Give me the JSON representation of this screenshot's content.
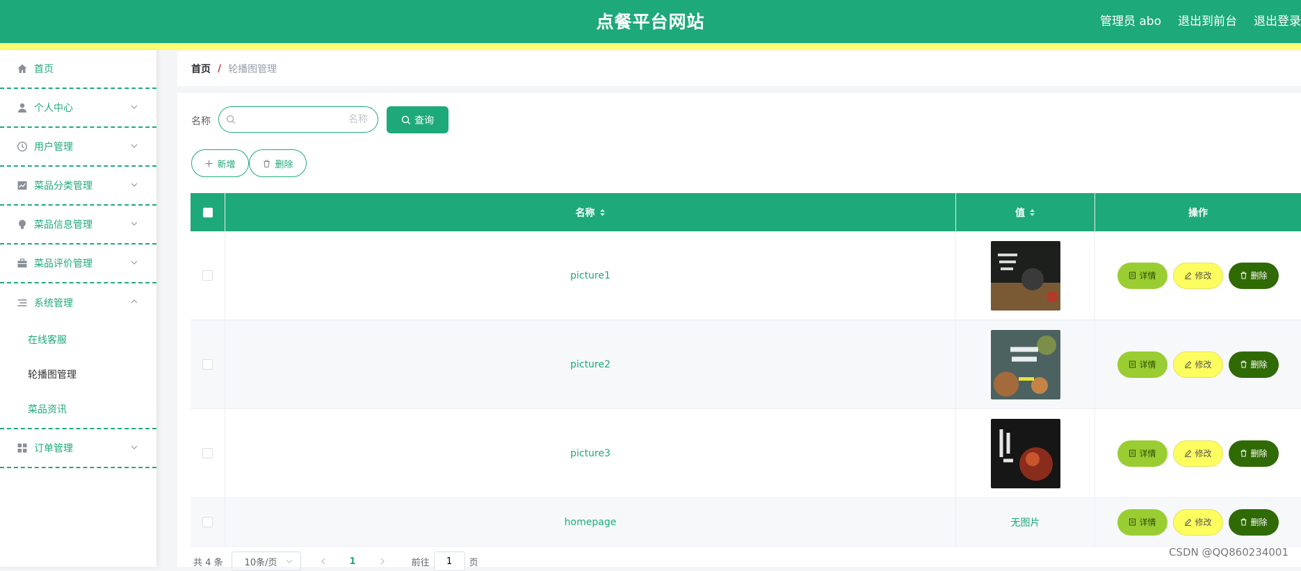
{
  "header": {
    "title": "点餐平台网站",
    "user_label": "管理员 abo",
    "front_link": "退出到前台",
    "logout_link": "退出登录"
  },
  "sidebar": {
    "items": [
      {
        "label": "首页",
        "icon": "home-icon"
      },
      {
        "label": "个人中心",
        "icon": "user-icon"
      },
      {
        "label": "用户管理",
        "icon": "clock-icon"
      },
      {
        "label": "菜品分类管理",
        "icon": "chart-icon"
      },
      {
        "label": "菜品信息管理",
        "icon": "bulb-icon"
      },
      {
        "label": "菜品评价管理",
        "icon": "briefcase-icon"
      },
      {
        "label": "系统管理",
        "icon": "list-icon"
      },
      {
        "label": "订单管理",
        "icon": "grid-icon"
      }
    ],
    "sub_items": [
      "在线客服",
      "轮播图管理",
      "菜品资讯"
    ]
  },
  "breadcrumb": {
    "home": "首页",
    "sep": "/",
    "current": "轮播图管理"
  },
  "search": {
    "label": "名称",
    "placeholder": "名称",
    "value": "",
    "button": "查询"
  },
  "toolbar": {
    "add": "新增",
    "delete": "删除"
  },
  "table": {
    "headers": {
      "name": "名称",
      "value": "值",
      "ops": "操作"
    },
    "rows": [
      {
        "name": "picture1",
        "value": "image"
      },
      {
        "name": "picture2",
        "value": "image"
      },
      {
        "name": "picture3",
        "value": "image"
      },
      {
        "name": "homepage",
        "value": "无图片"
      }
    ],
    "ops": {
      "detail": "详情",
      "edit": "修改",
      "delete": "删除"
    }
  },
  "pagination": {
    "total": "共 4 条",
    "page_size": "10条/页",
    "current": "1",
    "goto_prefix": "前往",
    "goto_value": "1",
    "goto_suffix": "页"
  },
  "watermark": "CSDN @QQ860234001",
  "colors": {
    "primary": "#1ea97b",
    "accent_yellow": "#fcfd72",
    "detail": "#9acd32",
    "edit": "#fcfd5e",
    "delete": "#2f6a05"
  }
}
